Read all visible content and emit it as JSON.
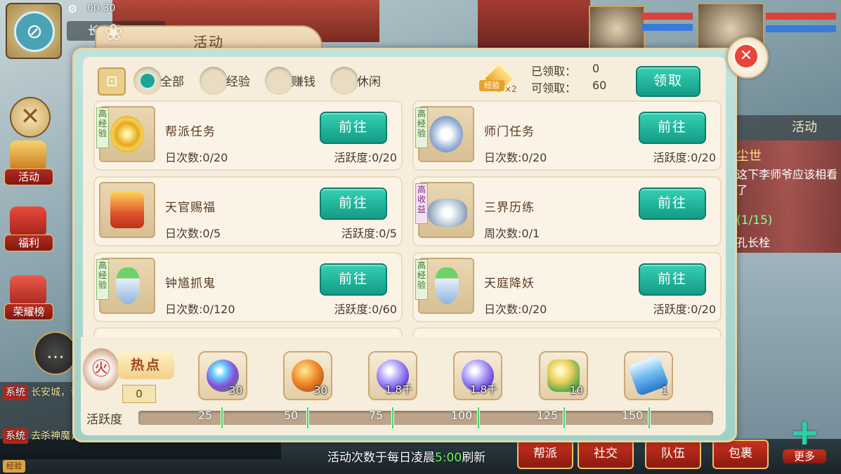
{
  "hud": {
    "clock": "00:30",
    "city_name": "长安城",
    "side_buttons": [
      "活动",
      "福利",
      "荣耀榜"
    ],
    "chat": {
      "line1_tag": "系统",
      "line1_text": "长安城，请少侠等着您！！！",
      "line2_tag": "系统",
      "line2_text": "去杀神魔，得百宝箱、百宝箱钥匙！~",
      "voice_tag": "经验"
    },
    "right_panel": {
      "tab": "活动",
      "quest_title": "尘世",
      "quest_desc": "这下李师爷应该相看了",
      "quest_progress": "(1/15)",
      "quest_target": "孔长栓"
    },
    "bottom_menu": [
      "帮派",
      "社交",
      "队伍",
      "包裹"
    ],
    "more_label": "更多"
  },
  "dialog": {
    "title": "活动",
    "filters": [
      {
        "label": "全部",
        "selected": true
      },
      {
        "label": "经验",
        "selected": false
      },
      {
        "label": "赚钱",
        "selected": false
      },
      {
        "label": "休闲",
        "selected": false
      }
    ],
    "bonus_label": "经验",
    "bonus_mult": "×2",
    "claimed_text": "已领取：",
    "claimed_value": "0",
    "claimable_text": "可领取：",
    "claimable_value": "60",
    "claim_button": "领取",
    "activities": [
      {
        "tag": "高经验",
        "tag_type": "exp",
        "name": "帮派任务",
        "daily": "日次数:0/20",
        "activity": "活跃度:0/20",
        "go": "前往",
        "icon": "gold-ring-icon"
      },
      {
        "tag": "高经验",
        "tag_type": "exp",
        "name": "师门任务",
        "daily": "日次数:0/20",
        "activity": "活跃度:0/20",
        "go": "前往",
        "icon": "silver-coin-icon"
      },
      {
        "tag": "",
        "tag_type": "none",
        "name": "天官赐福",
        "daily": "日次数:0/5",
        "activity": "活跃度:0/5",
        "go": "前往",
        "icon": "treasure-chest-icon"
      },
      {
        "tag": "高收益",
        "tag_type": "income",
        "name": "三界历练",
        "daily": "周次数:0/1",
        "activity": "",
        "go": "前往",
        "icon": "silver-ingot-icon"
      },
      {
        "tag": "高经验",
        "tag_type": "exp",
        "name": "钟馗抓鬼",
        "daily": "日次数:0/120",
        "activity": "活跃度:0/60",
        "go": "前往",
        "icon": "vase-icon"
      },
      {
        "tag": "高经验",
        "tag_type": "exp",
        "name": "天庭降妖",
        "daily": "日次数:0/20",
        "activity": "活跃度:0/20",
        "go": "前往",
        "icon": "vase-icon"
      }
    ],
    "hot": {
      "label": "热点",
      "count": "0"
    },
    "rewards": [
      {
        "icon": "rainbow-orb-icon",
        "qty": "30"
      },
      {
        "icon": "orange-fruit-icon",
        "qty": "30"
      },
      {
        "icon": "purple-cloud-orb-icon",
        "qty": "1.8千"
      },
      {
        "icon": "purple-cloud-orb-icon",
        "qty": "1.8千"
      },
      {
        "icon": "jade-key-icon",
        "qty": "10"
      },
      {
        "icon": "blue-talisman-icon",
        "qty": "1"
      }
    ],
    "activity_label": "活跃度",
    "activity_progress": 0,
    "milestones": [
      "25",
      "50",
      "75",
      "100",
      "125",
      "150"
    ],
    "refresh_prefix": "活动次数于每日凌晨",
    "refresh_time": "5:00",
    "refresh_suffix": "刷新"
  },
  "colors": {
    "accent": "#1fa394",
    "title_brown": "#6a4a2a",
    "button_red": "#c8321f"
  }
}
